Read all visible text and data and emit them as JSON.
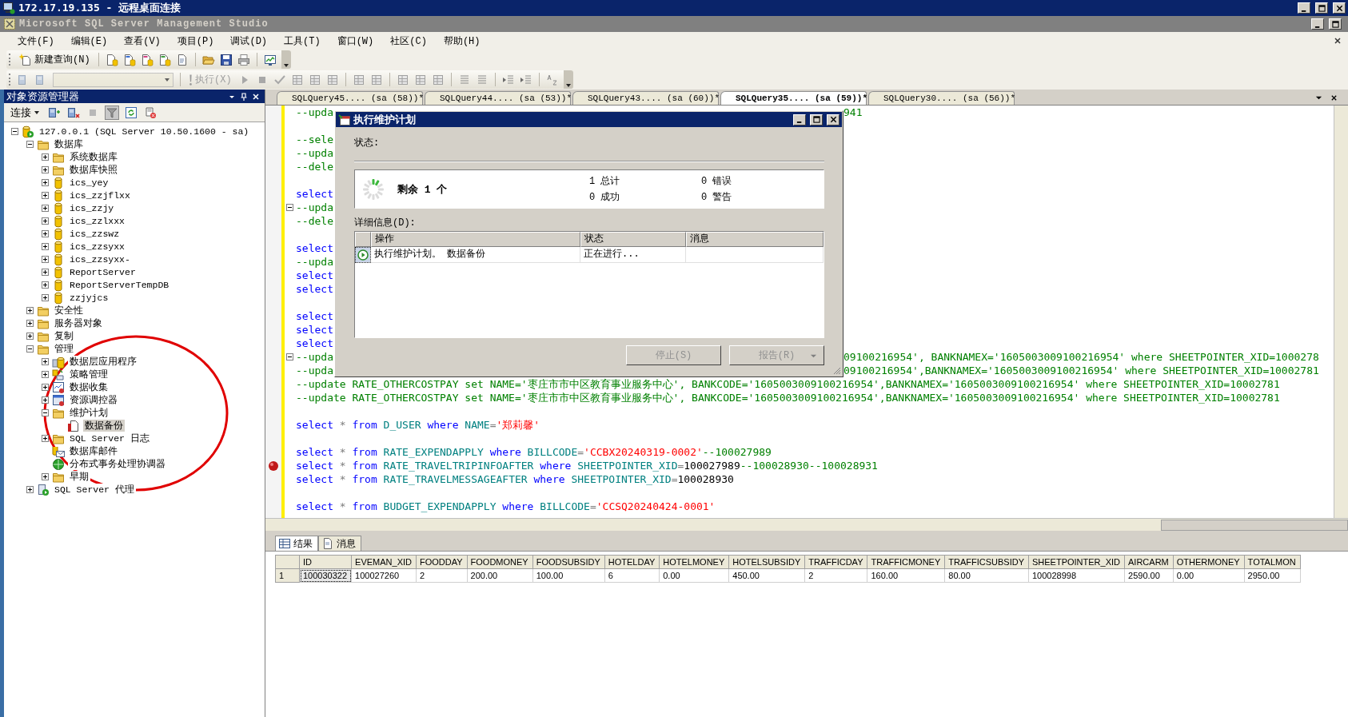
{
  "remote_window": {
    "title": "172.17.19.135 - 远程桌面连接"
  },
  "app_window": {
    "title": "Microsoft SQL Server Management Studio"
  },
  "menu": [
    "文件(F)",
    "编辑(E)",
    "查看(V)",
    "项目(P)",
    "调试(D)",
    "工具(T)",
    "窗口(W)",
    "社区(C)",
    "帮助(H)"
  ],
  "toolbar": {
    "new_query": "新建查询(N)",
    "database_selector": {
      "disabled": true
    },
    "execute": {
      "label": "执行(X)",
      "disabled": true
    }
  },
  "object_explorer": {
    "title": "对象资源管理器",
    "connect": "连接",
    "tree": [
      {
        "label": "127.0.0.1 (SQL Server 10.50.1600 - sa)",
        "kind": "server",
        "expanded": true,
        "selected": false,
        "children": [
          {
            "label": "数据库",
            "kind": "folder",
            "expanded": true,
            "selected": false,
            "children": [
              {
                "label": "系统数据库",
                "kind": "folder",
                "expanded": false,
                "selected": false
              },
              {
                "label": "数据库快照",
                "kind": "folder",
                "expanded": false,
                "selected": false
              },
              {
                "label": "ics_yey",
                "kind": "database",
                "expanded": false,
                "selected": false
              },
              {
                "label": "ics_zzjflxx",
                "kind": "database",
                "expanded": false,
                "selected": false
              },
              {
                "label": "ics_zzjy",
                "kind": "database",
                "expanded": false,
                "selected": false
              },
              {
                "label": "ics_zzlxxx",
                "kind": "database",
                "expanded": false,
                "selected": false
              },
              {
                "label": "ics_zzswz",
                "kind": "database",
                "expanded": false,
                "selected": false
              },
              {
                "label": "ics_zzsyxx",
                "kind": "database",
                "expanded": false,
                "selected": false
              },
              {
                "label": "ics_zzsyxx-",
                "kind": "database",
                "expanded": false,
                "selected": false
              },
              {
                "label": "ReportServer",
                "kind": "database",
                "expanded": false,
                "selected": false
              },
              {
                "label": "ReportServerTempDB",
                "kind": "database",
                "expanded": false,
                "selected": false
              },
              {
                "label": "zzjyjcs",
                "kind": "database",
                "expanded": false,
                "selected": false
              }
            ]
          },
          {
            "label": "安全性",
            "kind": "folder",
            "expanded": false,
            "selected": false
          },
          {
            "label": "服务器对象",
            "kind": "folder",
            "expanded": false,
            "selected": false
          },
          {
            "label": "复制",
            "kind": "folder",
            "expanded": false,
            "selected": false
          },
          {
            "label": "管理",
            "kind": "folder",
            "expanded": true,
            "selected": false,
            "children": [
              {
                "label": "数据层应用程序",
                "kind": "app",
                "expanded": false,
                "selected": false
              },
              {
                "label": "策略管理",
                "kind": "policy",
                "expanded": false,
                "selected": false
              },
              {
                "label": "数据收集",
                "kind": "collection",
                "expanded": false,
                "selected": false
              },
              {
                "label": "资源调控器",
                "kind": "governor",
                "expanded": false,
                "selected": false
              },
              {
                "label": "维护计划",
                "kind": "folder",
                "expanded": true,
                "selected": false,
                "children": [
                  {
                    "label": "数据备份",
                    "kind": "plan",
                    "selected": true
                  }
                ]
              },
              {
                "label": "SQL Server 日志",
                "kind": "folder",
                "expanded": false,
                "selected": false
              },
              {
                "label": "数据库邮件",
                "kind": "mail",
                "selected": false
              },
              {
                "label": "分布式事务处理协调器",
                "kind": "dtc",
                "selected": false
              },
              {
                "label": "早期",
                "kind": "folder",
                "expanded": false,
                "selected": false
              }
            ]
          },
          {
            "label": "SQL Server 代理",
            "kind": "agent",
            "expanded": false,
            "selected": false
          }
        ]
      }
    ]
  },
  "annotation": {
    "kind": "ellipse"
  },
  "tabs": [
    {
      "label": "SQLQuery45.... (sa (58))*",
      "selected": false
    },
    {
      "label": "SQLQuery44.... (sa (53))*",
      "selected": false
    },
    {
      "label": "SQLQuery43.... (sa (60))*",
      "selected": false
    },
    {
      "label": "SQLQuery35.... (sa (59))*",
      "selected": true
    },
    {
      "label": "SQLQuery30.... (sa (56))*",
      "selected": false
    }
  ],
  "editor": {
    "lines": [
      {
        "kind": "split",
        "breakpoint": false,
        "fold": false,
        "left": [
          {
            "text": "--upda",
            "kind": "comment"
          }
        ],
        "right": [
          {
            "text": "941",
            "kind": "comment"
          }
        ]
      },
      {
        "kind": "blank",
        "breakpoint": false,
        "fold": false
      },
      {
        "kind": "split",
        "breakpoint": false,
        "fold": false,
        "left": [
          {
            "text": "--sele",
            "kind": "comment"
          }
        ]
      },
      {
        "kind": "split",
        "breakpoint": false,
        "fold": false,
        "left": [
          {
            "text": "--upda",
            "kind": "comment"
          }
        ]
      },
      {
        "kind": "split",
        "breakpoint": false,
        "fold": false,
        "left": [
          {
            "text": "--dele",
            "kind": "comment"
          }
        ]
      },
      {
        "kind": "blank",
        "breakpoint": false,
        "fold": false
      },
      {
        "kind": "split",
        "breakpoint": false,
        "fold": false,
        "left": [
          {
            "text": "select",
            "kind": "keyword"
          }
        ]
      },
      {
        "kind": "split",
        "breakpoint": false,
        "fold": true,
        "left": [
          {
            "text": "--upda",
            "kind": "comment"
          }
        ]
      },
      {
        "kind": "split",
        "breakpoint": false,
        "fold": false,
        "left": [
          {
            "text": "--dele",
            "kind": "comment"
          }
        ]
      },
      {
        "kind": "blank",
        "breakpoint": false,
        "fold": false
      },
      {
        "kind": "split",
        "breakpoint": false,
        "fold": false,
        "left": [
          {
            "text": "select",
            "kind": "keyword"
          }
        ]
      },
      {
        "kind": "split",
        "breakpoint": false,
        "fold": false,
        "left": [
          {
            "text": "--upda",
            "kind": "comment"
          }
        ]
      },
      {
        "kind": "split",
        "breakpoint": false,
        "fold": false,
        "left": [
          {
            "text": "select",
            "kind": "keyword"
          }
        ]
      },
      {
        "kind": "split",
        "breakpoint": false,
        "fold": false,
        "left": [
          {
            "text": "select",
            "kind": "keyword"
          }
        ]
      },
      {
        "kind": "blank",
        "breakpoint": false,
        "fold": false
      },
      {
        "kind": "split",
        "breakpoint": false,
        "fold": false,
        "left": [
          {
            "text": "select",
            "kind": "keyword"
          }
        ]
      },
      {
        "kind": "split",
        "breakpoint": false,
        "fold": false,
        "left": [
          {
            "text": "select",
            "kind": "keyword"
          }
        ]
      },
      {
        "kind": "split",
        "breakpoint": false,
        "fold": false,
        "left": [
          {
            "text": "select",
            "kind": "keyword"
          }
        ]
      },
      {
        "kind": "split",
        "breakpoint": false,
        "fold": true,
        "left": [
          {
            "text": "--upda",
            "kind": "comment"
          }
        ],
        "right": [
          {
            "text": "09100216954', BANKNAMEX='1605003009100216954' where SHEETPOINTER_XID=1000278",
            "kind": "comment"
          }
        ]
      },
      {
        "kind": "split",
        "breakpoint": false,
        "fold": false,
        "left": [
          {
            "text": "--upda",
            "kind": "comment"
          }
        ],
        "right": [
          {
            "text": "09100216954',BANKNAMEX='1605003009100216954' where SHEETPOINTER_XID=10002781",
            "kind": "comment"
          }
        ]
      },
      {
        "kind": "full",
        "breakpoint": false,
        "fold": false,
        "tokens": [
          {
            "text": "--update RATE_OTHERCOSTPAY set NAME='枣庄市市中区教育事业服务中心', BANKCODE='1605003009100216954',BANKNAMEX='1605003009100216954' where SHEETPOINTER_XID=10002781",
            "kind": "comment"
          }
        ]
      },
      {
        "kind": "full",
        "breakpoint": false,
        "fold": false,
        "tokens": [
          {
            "text": "--update RATE_OTHERCOSTPAY set NAME='枣庄市市中区教育事业服务中心', BANKCODE='1605003009100216954',BANKNAMEX='1605003009100216954' where SHEETPOINTER_XID=10002781",
            "kind": "comment"
          }
        ]
      },
      {
        "kind": "blank",
        "breakpoint": false,
        "fold": false
      },
      {
        "kind": "full",
        "breakpoint": false,
        "fold": false,
        "tokens": [
          {
            "text": "select",
            "kind": "keyword"
          },
          {
            "text": " * ",
            "kind": "operator"
          },
          {
            "text": "from",
            "kind": "keyword"
          },
          {
            "text": " D_USER ",
            "kind": "object"
          },
          {
            "text": "where",
            "kind": "keyword"
          },
          {
            "text": " NAME",
            "kind": "object"
          },
          {
            "text": "=",
            "kind": "operator"
          },
          {
            "text": "'郑莉馨'",
            "kind": "string"
          }
        ]
      },
      {
        "kind": "blank",
        "breakpoint": false,
        "fold": false
      },
      {
        "kind": "full",
        "breakpoint": false,
        "fold": false,
        "tokens": [
          {
            "text": "select",
            "kind": "keyword"
          },
          {
            "text": " * ",
            "kind": "operator"
          },
          {
            "text": "from",
            "kind": "keyword"
          },
          {
            "text": " RATE_EXPENDAPPLY ",
            "kind": "object"
          },
          {
            "text": "where",
            "kind": "keyword"
          },
          {
            "text": " BILLCODE",
            "kind": "object"
          },
          {
            "text": "=",
            "kind": "operator"
          },
          {
            "text": "'CCBX20240319-0002'",
            "kind": "string"
          },
          {
            "text": "--100027989",
            "kind": "comment"
          }
        ]
      },
      {
        "kind": "full",
        "breakpoint": true,
        "fold": false,
        "tokens": [
          {
            "text": "select",
            "kind": "keyword"
          },
          {
            "text": " * ",
            "kind": "operator"
          },
          {
            "text": "from",
            "kind": "keyword"
          },
          {
            "text": " RATE_TRAVELTRIPINFOAFTER ",
            "kind": "object"
          },
          {
            "text": "where",
            "kind": "keyword"
          },
          {
            "text": " SHEETPOINTER_XID",
            "kind": "object"
          },
          {
            "text": "=",
            "kind": "operator"
          },
          {
            "text": "100027989",
            "kind": "plain"
          },
          {
            "text": "--100028930--100028931",
            "kind": "comment"
          }
        ]
      },
      {
        "kind": "full",
        "breakpoint": false,
        "fold": false,
        "tokens": [
          {
            "text": "select",
            "kind": "keyword"
          },
          {
            "text": " * ",
            "kind": "operator"
          },
          {
            "text": "from",
            "kind": "keyword"
          },
          {
            "text": " RATE_TRAVELMESSAGEAFTER ",
            "kind": "object"
          },
          {
            "text": "where",
            "kind": "keyword"
          },
          {
            "text": " SHEETPOINTER_XID",
            "kind": "object"
          },
          {
            "text": "=",
            "kind": "operator"
          },
          {
            "text": "100028930",
            "kind": "plain"
          }
        ]
      },
      {
        "kind": "blank",
        "breakpoint": false,
        "fold": false
      },
      {
        "kind": "full",
        "breakpoint": false,
        "fold": false,
        "tokens": [
          {
            "text": "select",
            "kind": "keyword"
          },
          {
            "text": " * ",
            "kind": "operator"
          },
          {
            "text": "from",
            "kind": "keyword"
          },
          {
            "text": " BUDGET_EXPENDAPPLY ",
            "kind": "object"
          },
          {
            "text": "where",
            "kind": "keyword"
          },
          {
            "text": " BILLCODE",
            "kind": "object"
          },
          {
            "text": "=",
            "kind": "operator"
          },
          {
            "text": "'CCSQ20240424-0001'",
            "kind": "string"
          }
        ]
      }
    ]
  },
  "results": {
    "tabs": [
      {
        "label": "结果",
        "kind": "grid",
        "selected": true
      },
      {
        "label": "消息",
        "kind": "messages",
        "selected": false
      }
    ],
    "columns": [
      "ID",
      "EVEMAN_XID",
      "FOODDAY",
      "FOODMONEY",
      "FOODSUBSIDY",
      "HOTELDAY",
      "HOTELMONEY",
      "HOTELSUBSIDY",
      "TRAFFICDAY",
      "TRAFFICMONEY",
      "TRAFFICSUBSIDY",
      "SHEETPOINTER_XID",
      "AIRCARM",
      "OTHERMONEY",
      "TOTALMON"
    ],
    "rows": [
      {
        "number": "1",
        "cells": [
          "100030322",
          "100027260",
          "2",
          "200.00",
          "100.00",
          "6",
          "0.00",
          "450.00",
          "2",
          "160.00",
          "80.00",
          "100028998",
          "2590.00",
          "0.00",
          "2950.00"
        ]
      }
    ]
  },
  "dialog": {
    "title": "执行维护计划",
    "status_label": "状态:",
    "remaining": "剩余 1 个",
    "stats": [
      "1 总计",
      "0 错误",
      "0 成功",
      "0 警告"
    ],
    "details_label": "详细信息(D):",
    "columns": [
      "操作",
      "状态",
      "消息"
    ],
    "rows": [
      {
        "action": "执行维护计划。 数据备份",
        "status": "正在进行..."
      }
    ],
    "buttons": [
      {
        "label": "停止(S)",
        "kind": "plain",
        "disabled": true
      },
      {
        "label": "报告(R)",
        "kind": "split",
        "disabled": true
      }
    ]
  }
}
